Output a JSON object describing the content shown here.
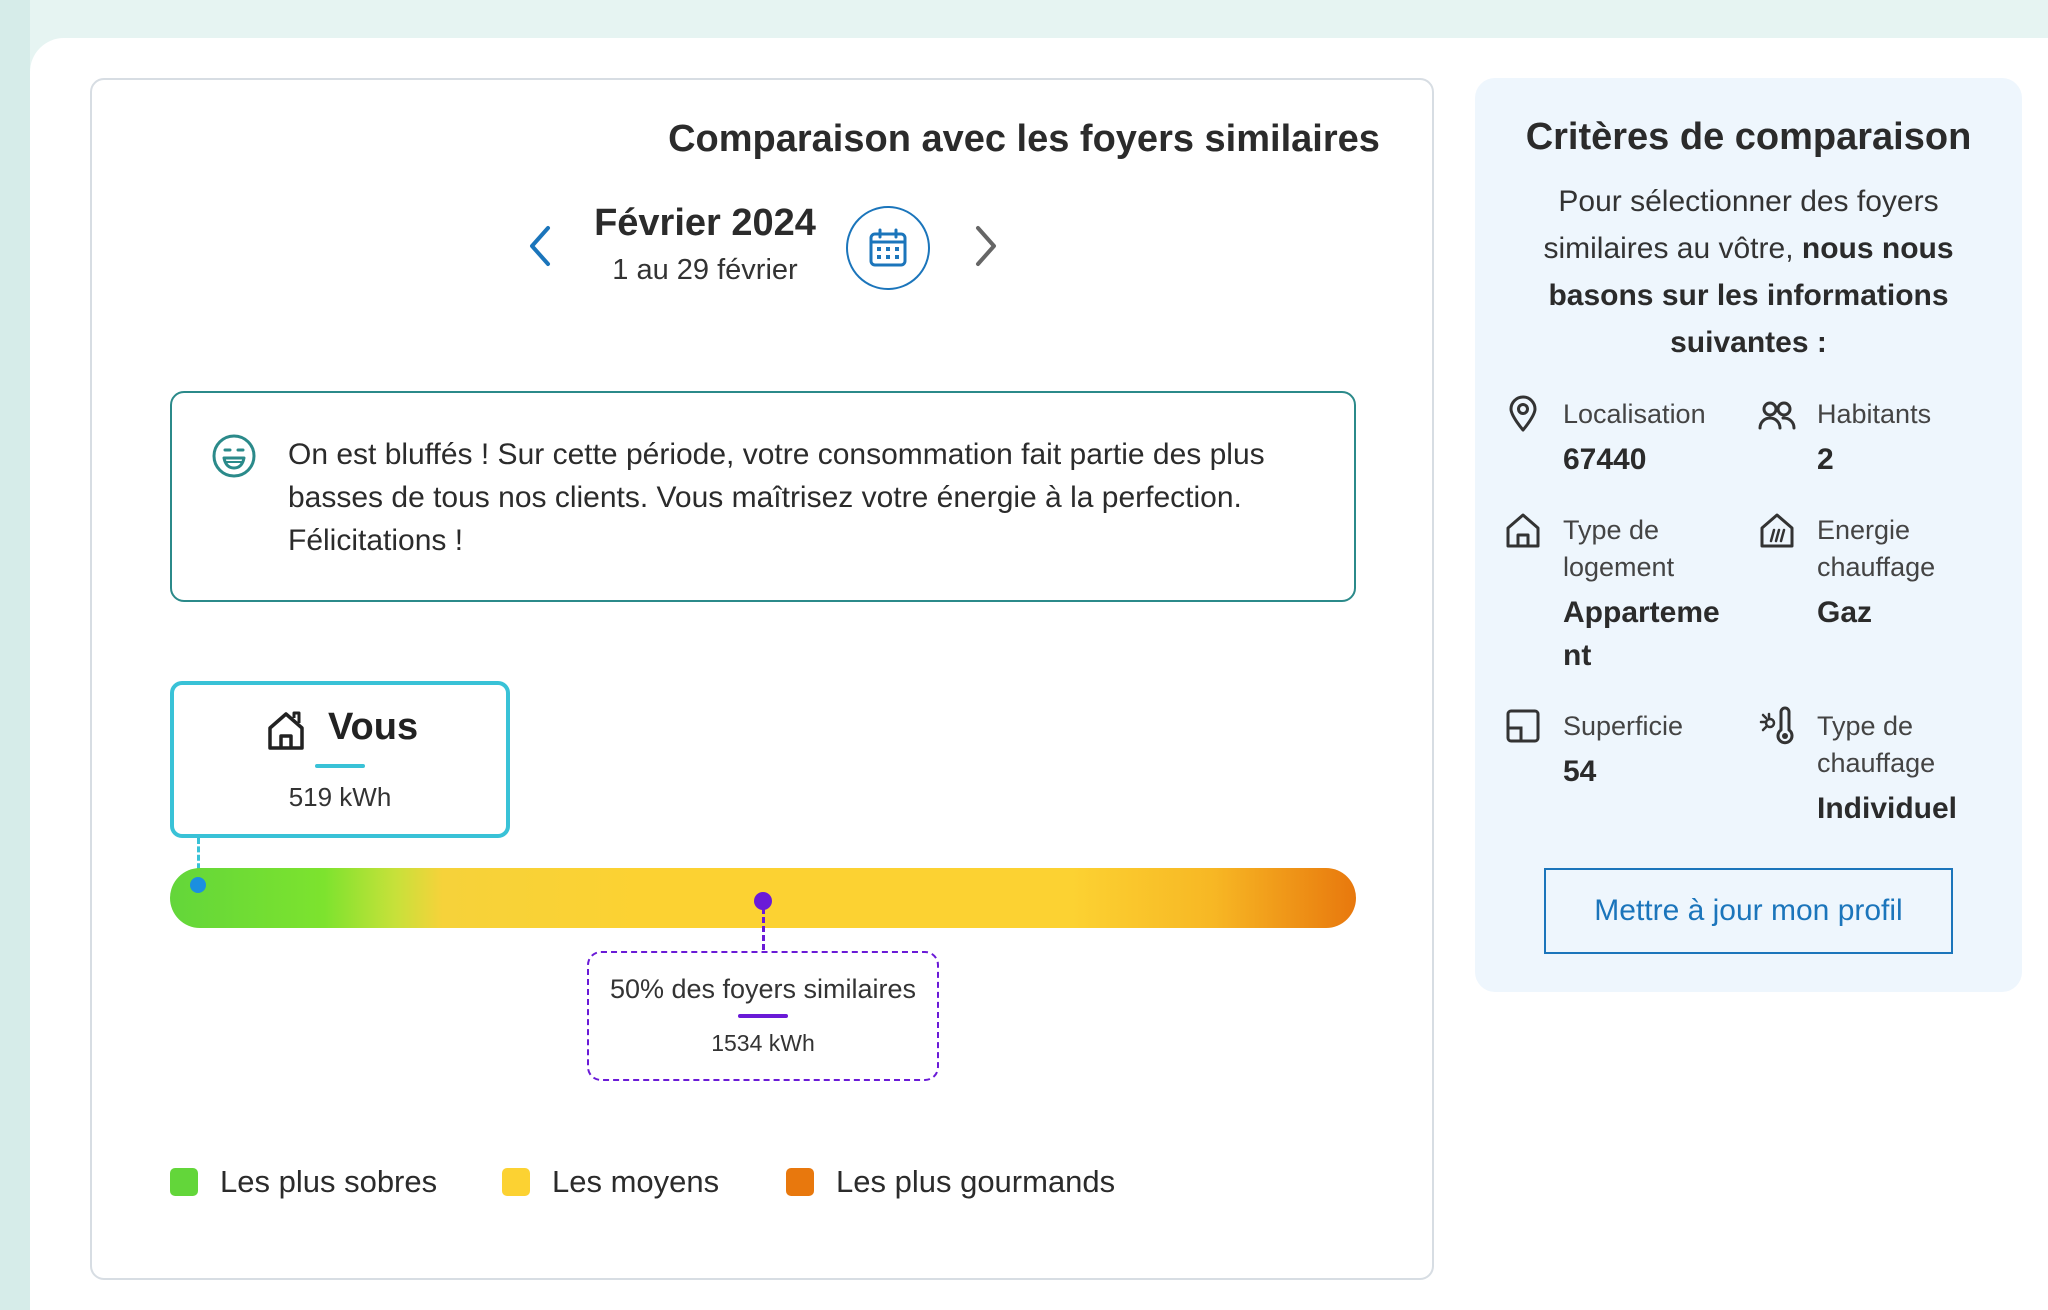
{
  "comparison": {
    "title": "Comparaison avec les foyers similaires",
    "period": {
      "month": "Février 2024",
      "range": "1 au 29 février"
    },
    "message": "On est bluffés ! Sur cette période, votre consommation fait partie des plus basses de tous nos clients. Vous maîtrisez votre énergie à la perfection. Félicitations !",
    "you": {
      "label": "Vous",
      "value": "519 kWh"
    },
    "average": {
      "label": "50% des foyers similaires",
      "value": "1534 kWh"
    },
    "legend": [
      {
        "label": "Les plus sobres",
        "color": "#63d63a"
      },
      {
        "label": "Les moyens",
        "color": "#fcd232"
      },
      {
        "label": "Les plus gourmands",
        "color": "#e8780d"
      }
    ]
  },
  "criteria": {
    "title": "Critères de comparaison",
    "intro": "Pour sélectionner des foyers similaires au vôtre,",
    "intro_bold": "nous nous basons sur les informations suivantes :",
    "items": [
      {
        "label": "Localisation",
        "value": "67440",
        "icon": "location-pin-icon"
      },
      {
        "label": "Habitants",
        "value": "2",
        "icon": "people-icon"
      },
      {
        "label": "Type de logement",
        "value": "Appartement",
        "icon": "house-icon"
      },
      {
        "label": "Energie chauffage",
        "value": "Gaz",
        "icon": "heating-energy-icon"
      },
      {
        "label": "Superficie",
        "value": "54",
        "icon": "floor-area-icon"
      },
      {
        "label": "Type de chauffage",
        "value": "Individuel",
        "icon": "thermometer-icon"
      }
    ],
    "update_button": "Mettre à jour mon profil"
  },
  "colors": {
    "accent": "#1b75bb",
    "teal": "#2b8a8a",
    "you": "#39c2d7",
    "average": "#6a1ad7"
  }
}
